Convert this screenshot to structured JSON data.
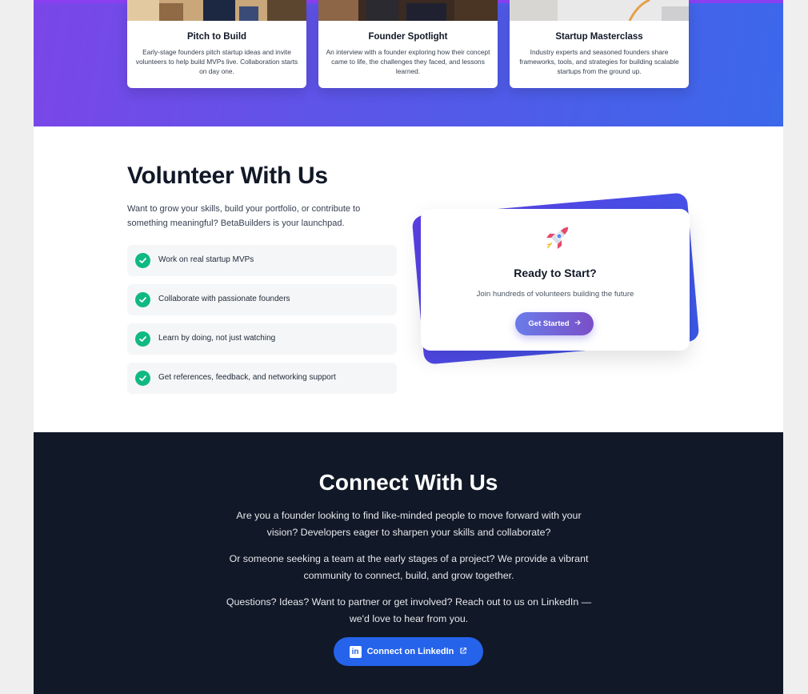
{
  "events": {
    "cards": [
      {
        "title": "Pitch to Build",
        "description": "Early-stage founders pitch startup ideas and invite volunteers to help build MVPs live. Collaboration starts on day one."
      },
      {
        "title": "Founder Spotlight",
        "description": "An interview with a founder exploring how their concept came to life, the challenges they faced, and lessons learned."
      },
      {
        "title": "Startup Masterclass",
        "description": "Industry experts and seasoned founders share frameworks, tools, and strategies for building scalable startups from the ground up."
      }
    ]
  },
  "volunteer": {
    "title": "Volunteer With Us",
    "description": "Want to grow your skills, build your portfolio, or contribute to something meaningful? BetaBuilders is your launchpad.",
    "benefits": [
      "Work on real startup MVPs",
      "Collaborate with passionate founders",
      "Learn by doing, not just watching",
      "Get references, feedback, and networking support"
    ],
    "cta": {
      "title": "Ready to Start?",
      "subtitle": "Join hundreds of volunteers building the future",
      "button": "Get Started",
      "button_icon": "arrow-right-icon"
    }
  },
  "connect": {
    "title": "Connect With Us",
    "paragraphs": [
      "Are you a founder looking to find like-minded people to move forward with your vision? Developers eager to sharpen your skills and collaborate?",
      "Or someone seeking a team at the early stages of a project? We provide a vibrant community to connect, build, and grow together.",
      "Questions? Ideas? Want to partner or get involved? Reach out to us on LinkedIn — we'd love to hear from you."
    ],
    "button": "Connect on LinkedIn",
    "button_icons": [
      "linkedin-icon",
      "external-link-icon"
    ]
  },
  "colors": {
    "gradient_start": "#7b46e8",
    "gradient_end": "#3b68ea",
    "check_green": "#10b981",
    "dark_bg": "#111827",
    "linkedin_blue": "#2563eb"
  }
}
